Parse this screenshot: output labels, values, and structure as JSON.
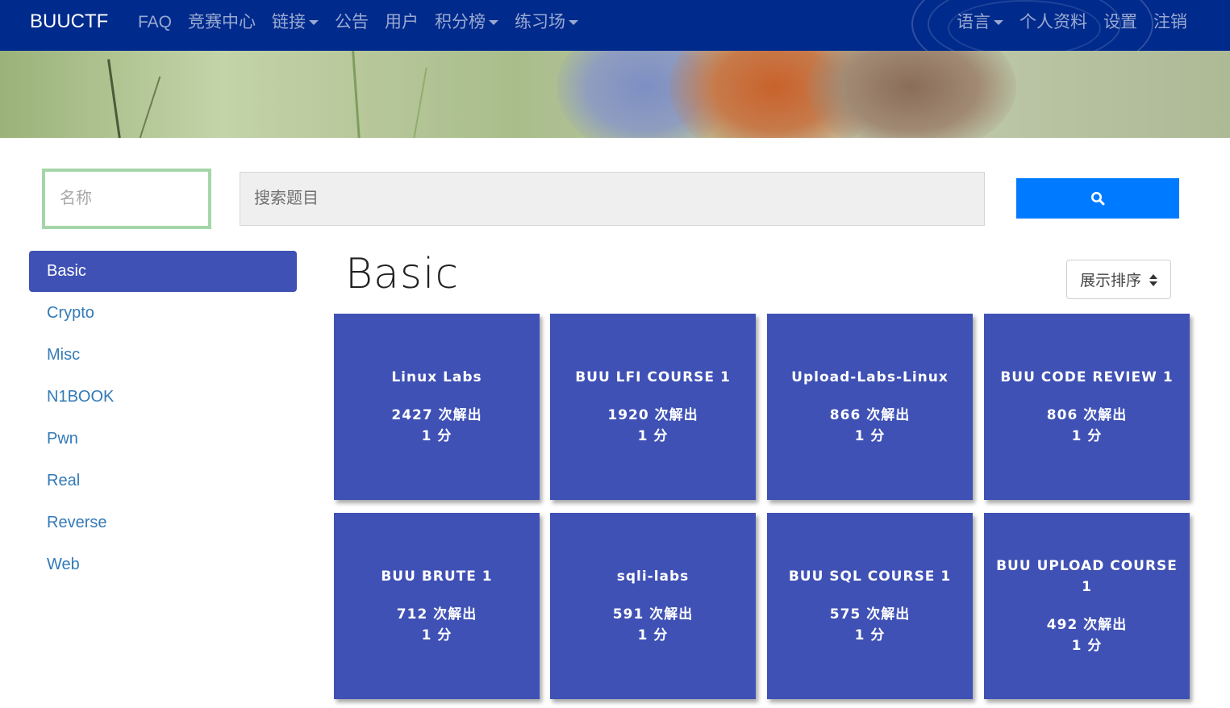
{
  "navbar": {
    "brand": "BUUCTF",
    "left_links": [
      {
        "label": "FAQ",
        "dropdown": false
      },
      {
        "label": "竞赛中心",
        "dropdown": false
      },
      {
        "label": "链接",
        "dropdown": true
      },
      {
        "label": "公告",
        "dropdown": false
      },
      {
        "label": "用户",
        "dropdown": false
      },
      {
        "label": "积分榜",
        "dropdown": true
      },
      {
        "label": "练习场",
        "dropdown": true
      }
    ],
    "right_links": [
      {
        "label": "语言",
        "dropdown": true
      },
      {
        "label": "个人资料",
        "dropdown": false
      },
      {
        "label": "设置",
        "dropdown": false
      },
      {
        "label": "注销",
        "dropdown": false
      }
    ]
  },
  "search": {
    "name_placeholder": "名称",
    "query_placeholder": "搜索题目",
    "button_icon": "search-icon"
  },
  "sidebar": {
    "items": [
      {
        "label": "Basic",
        "active": true
      },
      {
        "label": "Crypto",
        "active": false
      },
      {
        "label": "Misc",
        "active": false
      },
      {
        "label": "N1BOOK",
        "active": false
      },
      {
        "label": "Pwn",
        "active": false
      },
      {
        "label": "Real",
        "active": false
      },
      {
        "label": "Reverse",
        "active": false
      },
      {
        "label": "Web",
        "active": false
      }
    ]
  },
  "main": {
    "category_title": "Basic",
    "sort_label": "展示排序"
  },
  "challenges": [
    {
      "name": "Linux Labs",
      "solves": "2427 次解出",
      "points": "1 分"
    },
    {
      "name": "BUU LFI COURSE 1",
      "solves": "1920 次解出",
      "points": "1 分"
    },
    {
      "name": "Upload-Labs-Linux",
      "solves": "866 次解出",
      "points": "1 分"
    },
    {
      "name": "BUU CODE REVIEW 1",
      "solves": "806 次解出",
      "points": "1 分"
    },
    {
      "name": "BUU BRUTE 1",
      "solves": "712 次解出",
      "points": "1 分"
    },
    {
      "name": "sqli-labs",
      "solves": "591 次解出",
      "points": "1 分"
    },
    {
      "name": "BUU SQL COURSE 1",
      "solves": "575 次解出",
      "points": "1 分"
    },
    {
      "name": "BUU UPLOAD COURSE 1",
      "solves": "492 次解出",
      "points": "1 分"
    }
  ],
  "colors": {
    "navbar": "#002a8c",
    "accent": "#3f51b5",
    "search_button": "#007bff",
    "link": "#337ab7"
  }
}
